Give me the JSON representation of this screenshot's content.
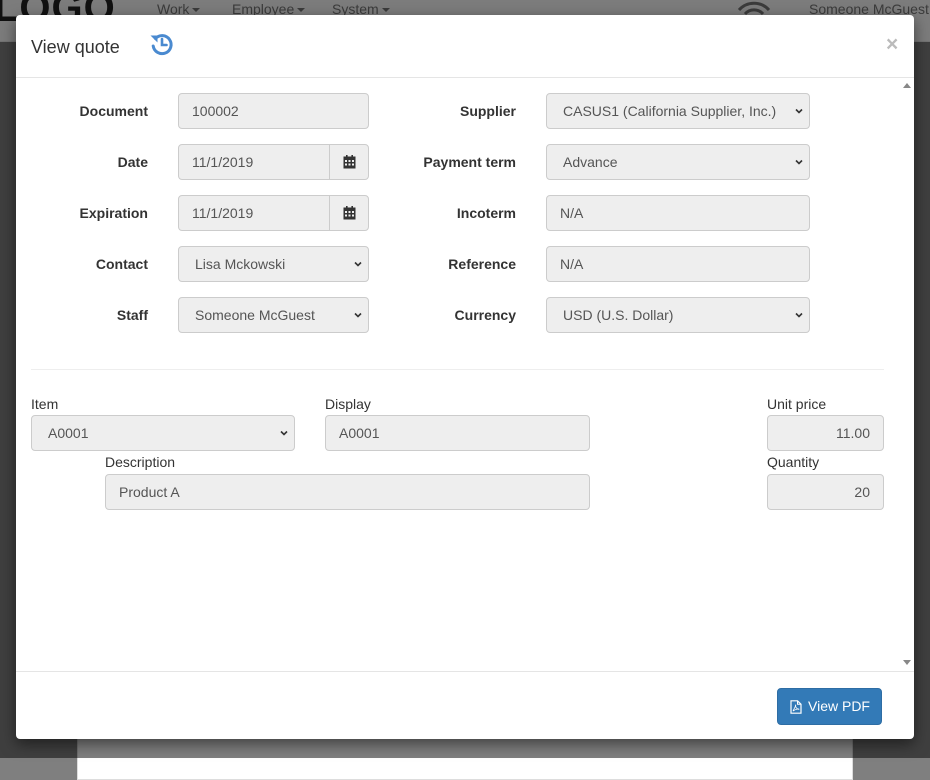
{
  "app": {
    "logo": "LOGO",
    "nav": [
      {
        "label": "Work"
      },
      {
        "label": "Employee"
      },
      {
        "label": "System"
      }
    ],
    "user": "Someone McGuest"
  },
  "modal": {
    "title": "View quote",
    "icons": {
      "history": "history-icon",
      "close": "close-icon"
    },
    "close_label": "×"
  },
  "form": {
    "document": {
      "label": "Document",
      "value": "100002"
    },
    "date": {
      "label": "Date",
      "value": "11/1/2019"
    },
    "expiration": {
      "label": "Expiration",
      "value": "11/1/2019"
    },
    "contact": {
      "label": "Contact",
      "value": "Lisa Mckowski"
    },
    "staff": {
      "label": "Staff",
      "value": "Someone McGuest"
    },
    "supplier": {
      "label": "Supplier",
      "value": "CASUS1 (California Supplier, Inc.)"
    },
    "payment_term": {
      "label": "Payment term",
      "value": "Advance"
    },
    "incoterm": {
      "label": "Incoterm",
      "value": "N/A"
    },
    "reference": {
      "label": "Reference",
      "value": "N/A"
    },
    "currency": {
      "label": "Currency",
      "value": "USD (U.S. Dollar)"
    }
  },
  "line_item": {
    "item": {
      "label": "Item",
      "value": "A0001"
    },
    "display": {
      "label": "Display",
      "value": "A0001"
    },
    "unit_price": {
      "label": "Unit price",
      "value": "11.00"
    },
    "description": {
      "label": "Description",
      "value": "Product A"
    },
    "quantity": {
      "label": "Quantity",
      "value": "20"
    }
  },
  "footer": {
    "view_pdf_label": "View PDF",
    "icon": "file-pdf-icon"
  },
  "colors": {
    "primary": "#337ab7",
    "icon_blue": "#4a8ad0",
    "field_bg": "#eeeeee"
  }
}
